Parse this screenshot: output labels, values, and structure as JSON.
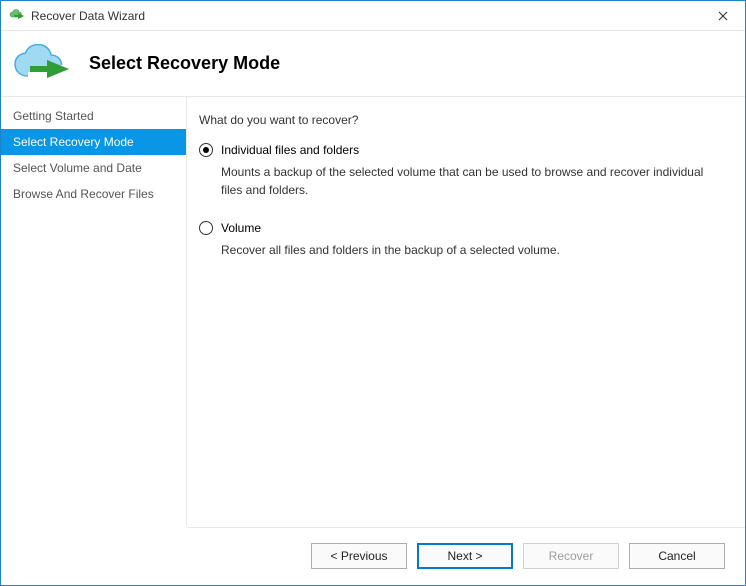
{
  "window": {
    "title": "Recover Data Wizard"
  },
  "header": {
    "title": "Select Recovery Mode"
  },
  "sidebar": {
    "items": [
      {
        "label": "Getting Started"
      },
      {
        "label": "Select Recovery Mode"
      },
      {
        "label": "Select Volume and Date"
      },
      {
        "label": "Browse And Recover Files"
      }
    ]
  },
  "content": {
    "prompt": "What do you want to recover?",
    "options": [
      {
        "label": "Individual files and folders",
        "description": "Mounts a backup of the selected volume that can be used to browse and recover individual files and folders.",
        "selected": true
      },
      {
        "label": "Volume",
        "description": "Recover all files and folders in the backup of a selected volume.",
        "selected": false
      }
    ]
  },
  "footer": {
    "previous": "< Previous",
    "next": "Next >",
    "recover": "Recover",
    "cancel": "Cancel"
  }
}
